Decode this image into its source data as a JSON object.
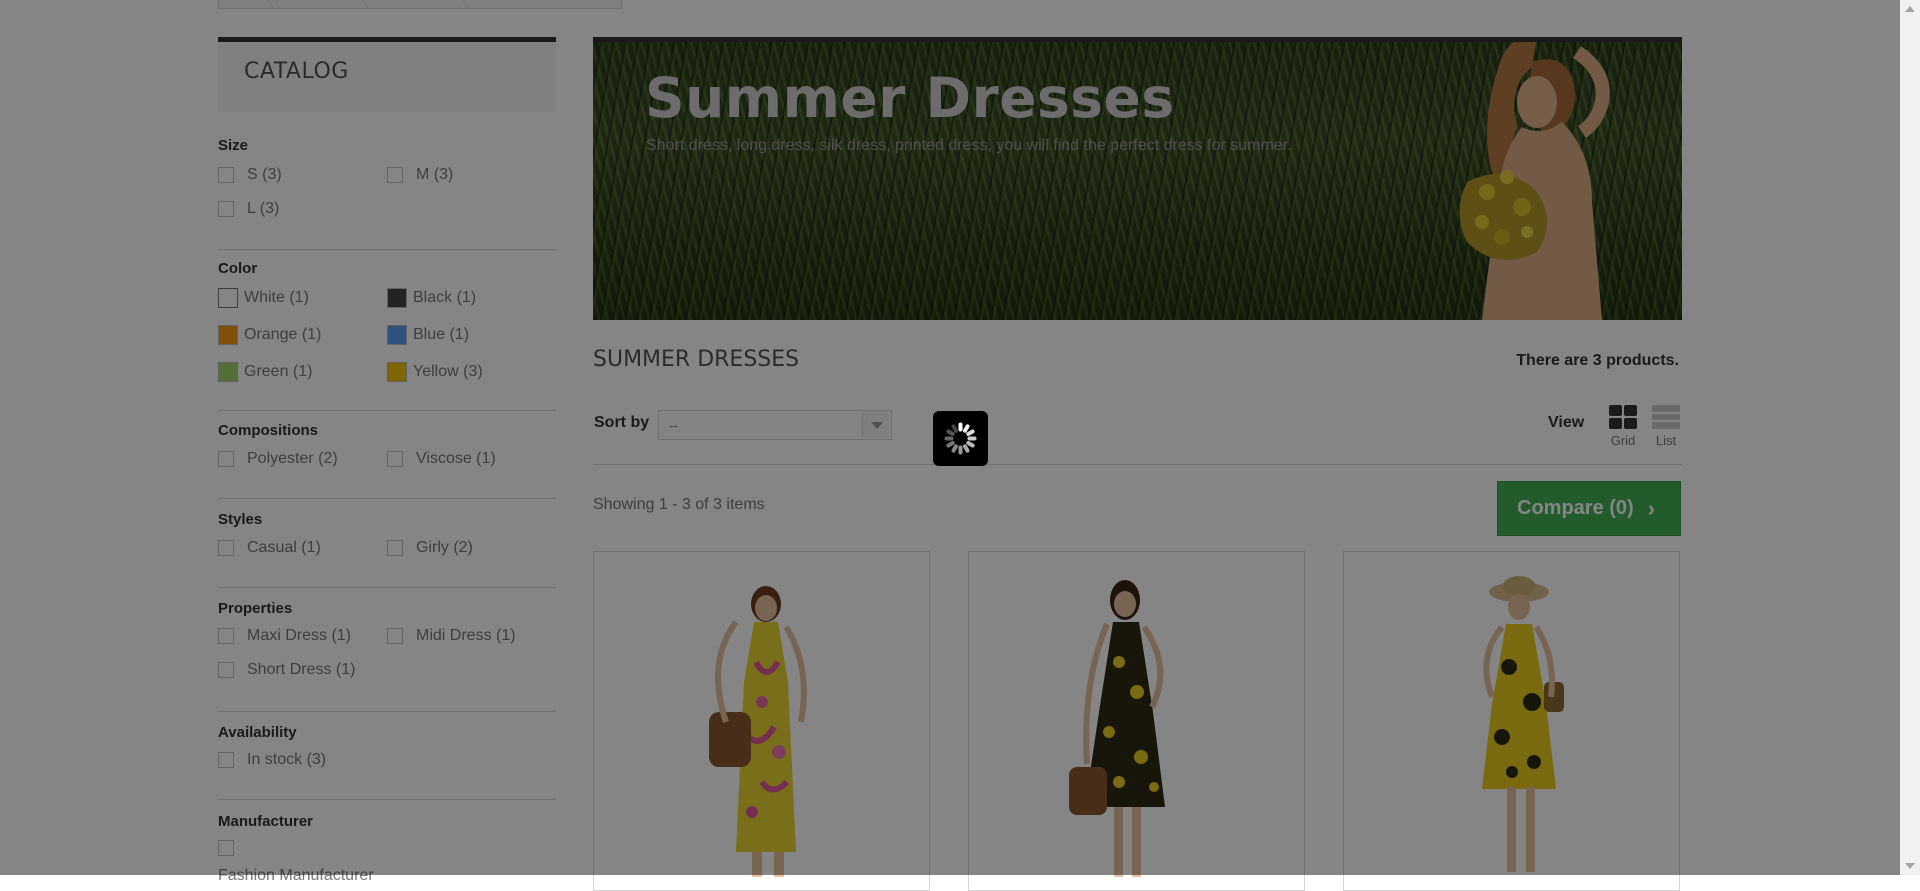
{
  "sidebar": {
    "catalog_title": "CATALOG",
    "filters": {
      "size": {
        "title": "Size",
        "options": [
          "S (3)",
          "M (3)",
          "L (3)"
        ]
      },
      "color": {
        "title": "Color",
        "options": [
          {
            "label": "White (1)",
            "color": "#ffffff"
          },
          {
            "label": "Black (1)",
            "color": "#434343"
          },
          {
            "label": "Orange (1)",
            "color": "#f39c11"
          },
          {
            "label": "Blue (1)",
            "color": "#5d9cec"
          },
          {
            "label": "Green (1)",
            "color": "#a0d468"
          },
          {
            "label": "Yellow (3)",
            "color": "#f1c40f"
          }
        ]
      },
      "compositions": {
        "title": "Compositions",
        "options": [
          "Polyester (2)",
          "Viscose (1)"
        ]
      },
      "styles": {
        "title": "Styles",
        "options": [
          "Casual (1)",
          "Girly (2)"
        ]
      },
      "properties": {
        "title": "Properties",
        "options": [
          "Maxi Dress (1)",
          "Midi Dress (1)",
          "Short Dress (1)"
        ]
      },
      "availability": {
        "title": "Availability",
        "options": [
          "In stock (3)"
        ]
      },
      "manufacturer": {
        "title": "Manufacturer",
        "options": [
          "Fashion Manufacturer"
        ]
      }
    }
  },
  "banner": {
    "title": "Summer Dresses",
    "description": "Short dress, long dress, silk dress, printed dress, you will find the perfect dress for summer."
  },
  "content": {
    "heading": "SUMMER DRESSES",
    "product_count": "There are 3 products.",
    "sort_label": "Sort by",
    "sort_value": "--",
    "view_label": "View",
    "view_grid": "Grid",
    "view_list": "List",
    "showing": "Showing 1 - 3 of 3 items",
    "compare_label": "Compare (0)",
    "compare_icon": "chevron-right-icon"
  },
  "colors": {
    "compare_green": "#43b155",
    "overlay": "rgba(0,0,0,0.48)"
  },
  "products": [
    {
      "image": "woman-in-long-floral-yellow-dress"
    },
    {
      "image": "woman-in-dark-dress-with-yellow-flowers"
    },
    {
      "image": "woman-in-yellow-short-dress-with-hat"
    }
  ]
}
